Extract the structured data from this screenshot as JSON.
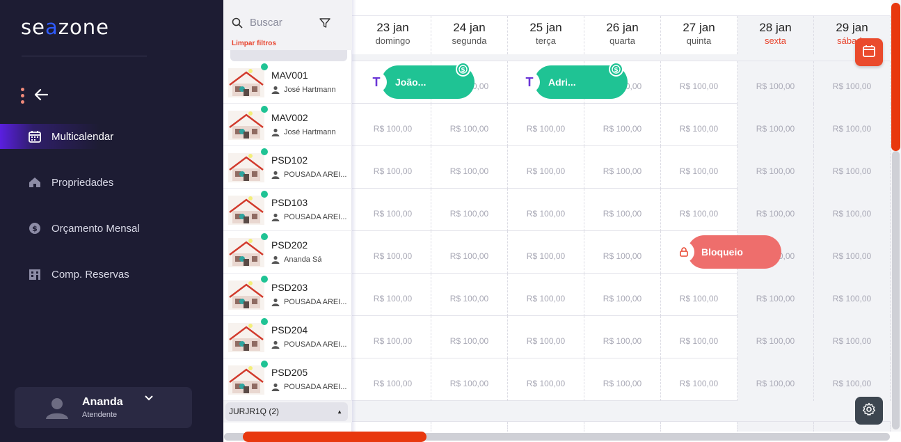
{
  "app": {
    "logo": {
      "pre": "se",
      "o": "a",
      "post": "zone"
    }
  },
  "sidebar": {
    "items": [
      {
        "label": "Multicalendar",
        "icon": "calendar-icon",
        "active": true
      },
      {
        "label": "Propriedades",
        "icon": "house-icon",
        "active": false
      },
      {
        "label": "Orçamento Mensal",
        "icon": "dollar-coin-icon",
        "active": false
      },
      {
        "label": "Comp. Reservas",
        "icon": "building-icon",
        "active": false
      }
    ],
    "user": {
      "name": "Ananda",
      "role": "Atendente"
    }
  },
  "search": {
    "placeholder": "Buscar",
    "clear_filters": "Limpar filtros"
  },
  "properties": [
    {
      "code": "MAV001",
      "owner": "José Hartmann"
    },
    {
      "code": "MAV002",
      "owner": "José Hartmann"
    },
    {
      "code": "PSD102",
      "owner": "POUSADA AREI..."
    },
    {
      "code": "PSD103",
      "owner": "POUSADA AREI..."
    },
    {
      "code": "PSD202",
      "owner": "Ananda Sá"
    },
    {
      "code": "PSD203",
      "owner": "POUSADA AREI..."
    },
    {
      "code": "PSD204",
      "owner": "POUSADA AREI..."
    },
    {
      "code": "PSD205",
      "owner": "POUSADA AREI..."
    }
  ],
  "group": {
    "label": "JURJR1Q (2)"
  },
  "calendar": {
    "days": [
      {
        "date": "23 jan",
        "weekday": "domingo",
        "weekend": false
      },
      {
        "date": "24 jan",
        "weekday": "segunda",
        "weekend": false
      },
      {
        "date": "25 jan",
        "weekday": "terça",
        "weekend": false
      },
      {
        "date": "26 jan",
        "weekday": "quarta",
        "weekend": false
      },
      {
        "date": "27 jan",
        "weekday": "quinta",
        "weekend": false
      },
      {
        "date": "28 jan",
        "weekday": "sexta",
        "weekend": true
      },
      {
        "date": "29 jan",
        "weekday": "sábado",
        "weekend": true
      }
    ],
    "price": "R$ 100,00",
    "bookings": [
      {
        "guest": "João...",
        "channel": "T",
        "status": "paid"
      },
      {
        "guest": "Adri...",
        "channel": "T",
        "status": "paid"
      }
    ],
    "block": {
      "label": "Bloqueio"
    }
  },
  "colors": {
    "sidebar_bg": "#1d1c33",
    "accent": "#e8380e",
    "booking": "#1fc394",
    "block": "#ee6e6c",
    "active_nav": "#5a1fe0"
  }
}
